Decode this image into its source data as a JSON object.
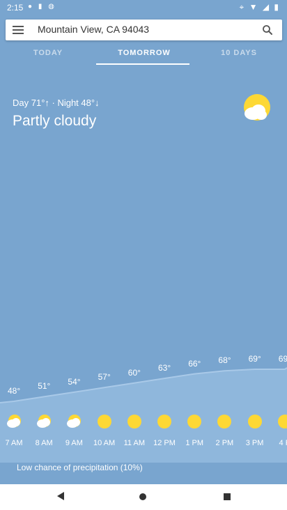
{
  "status": {
    "time": "2:15",
    "left_icons": [
      "settings-dot-icon",
      "sim-icon",
      "sync-icon"
    ],
    "right_icons": [
      "location-icon",
      "wifi-icon",
      "signal-icon",
      "battery-icon"
    ]
  },
  "search": {
    "location": "Mountain View, CA 94043"
  },
  "tabs": [
    {
      "label": "TODAY",
      "active": false
    },
    {
      "label": "TOMORROW",
      "active": true
    },
    {
      "label": "10 DAYS",
      "active": false
    }
  ],
  "forecast": {
    "day_night": "Day 71°↑ · Night 48°↓",
    "condition": "Partly cloudy",
    "condition_icon": "partly-cloudy-icon"
  },
  "hourly": [
    {
      "time": "7 AM",
      "temp": "48°",
      "icon": "partly-cloudy-icon"
    },
    {
      "time": "8 AM",
      "temp": "51°",
      "icon": "partly-cloudy-icon"
    },
    {
      "time": "9 AM",
      "temp": "54°",
      "icon": "partly-cloudy-icon"
    },
    {
      "time": "10 AM",
      "temp": "57°",
      "icon": "sunny-icon"
    },
    {
      "time": "11 AM",
      "temp": "60°",
      "icon": "sunny-icon"
    },
    {
      "time": "12 PM",
      "temp": "63°",
      "icon": "sunny-icon"
    },
    {
      "time": "1 PM",
      "temp": "66°",
      "icon": "sunny-icon"
    },
    {
      "time": "2 PM",
      "temp": "68°",
      "icon": "sunny-icon"
    },
    {
      "time": "3 PM",
      "temp": "69°",
      "icon": "sunny-icon"
    },
    {
      "time": "4 P",
      "temp": "69",
      "icon": "sunny-icon"
    }
  ],
  "precipitation": "Low chance of precipitation (10%)",
  "colors": {
    "sky": "#79a5cf",
    "sun": "#fdd835",
    "area": "#8fb7dc"
  }
}
